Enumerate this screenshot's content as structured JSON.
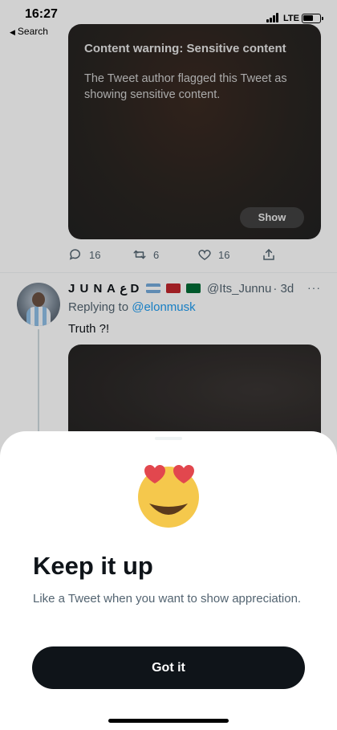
{
  "status_bar": {
    "time": "16:27",
    "back_label": "Search",
    "network": "LTE"
  },
  "tweet1": {
    "content_warning_title": "Content warning: Sensitive content",
    "content_warning_desc": "The Tweet author flagged this Tweet as showing sensitive content.",
    "show_label": "Show",
    "replies": "16",
    "retweets": "6",
    "likes": "16"
  },
  "tweet2": {
    "name": "J U N A ع D",
    "flags": [
      "argentina",
      "morocco",
      "saudi-arabia"
    ],
    "handle": "@Its_Junnu",
    "time": "· 3d",
    "more": "···",
    "replying_prefix": "Replying to",
    "replying_to": "@elonmusk",
    "text": "Truth ?!"
  },
  "sheet": {
    "emoji": "smiling-face-with-heart-eyes",
    "title": "Keep it up",
    "description": "Like a Tweet when you want to show appreciation.",
    "button_label": "Got it"
  },
  "colors": {
    "text_primary": "#0f1419",
    "text_secondary": "#536471",
    "link": "#1d9bf0",
    "button_bg": "#0f1419"
  }
}
